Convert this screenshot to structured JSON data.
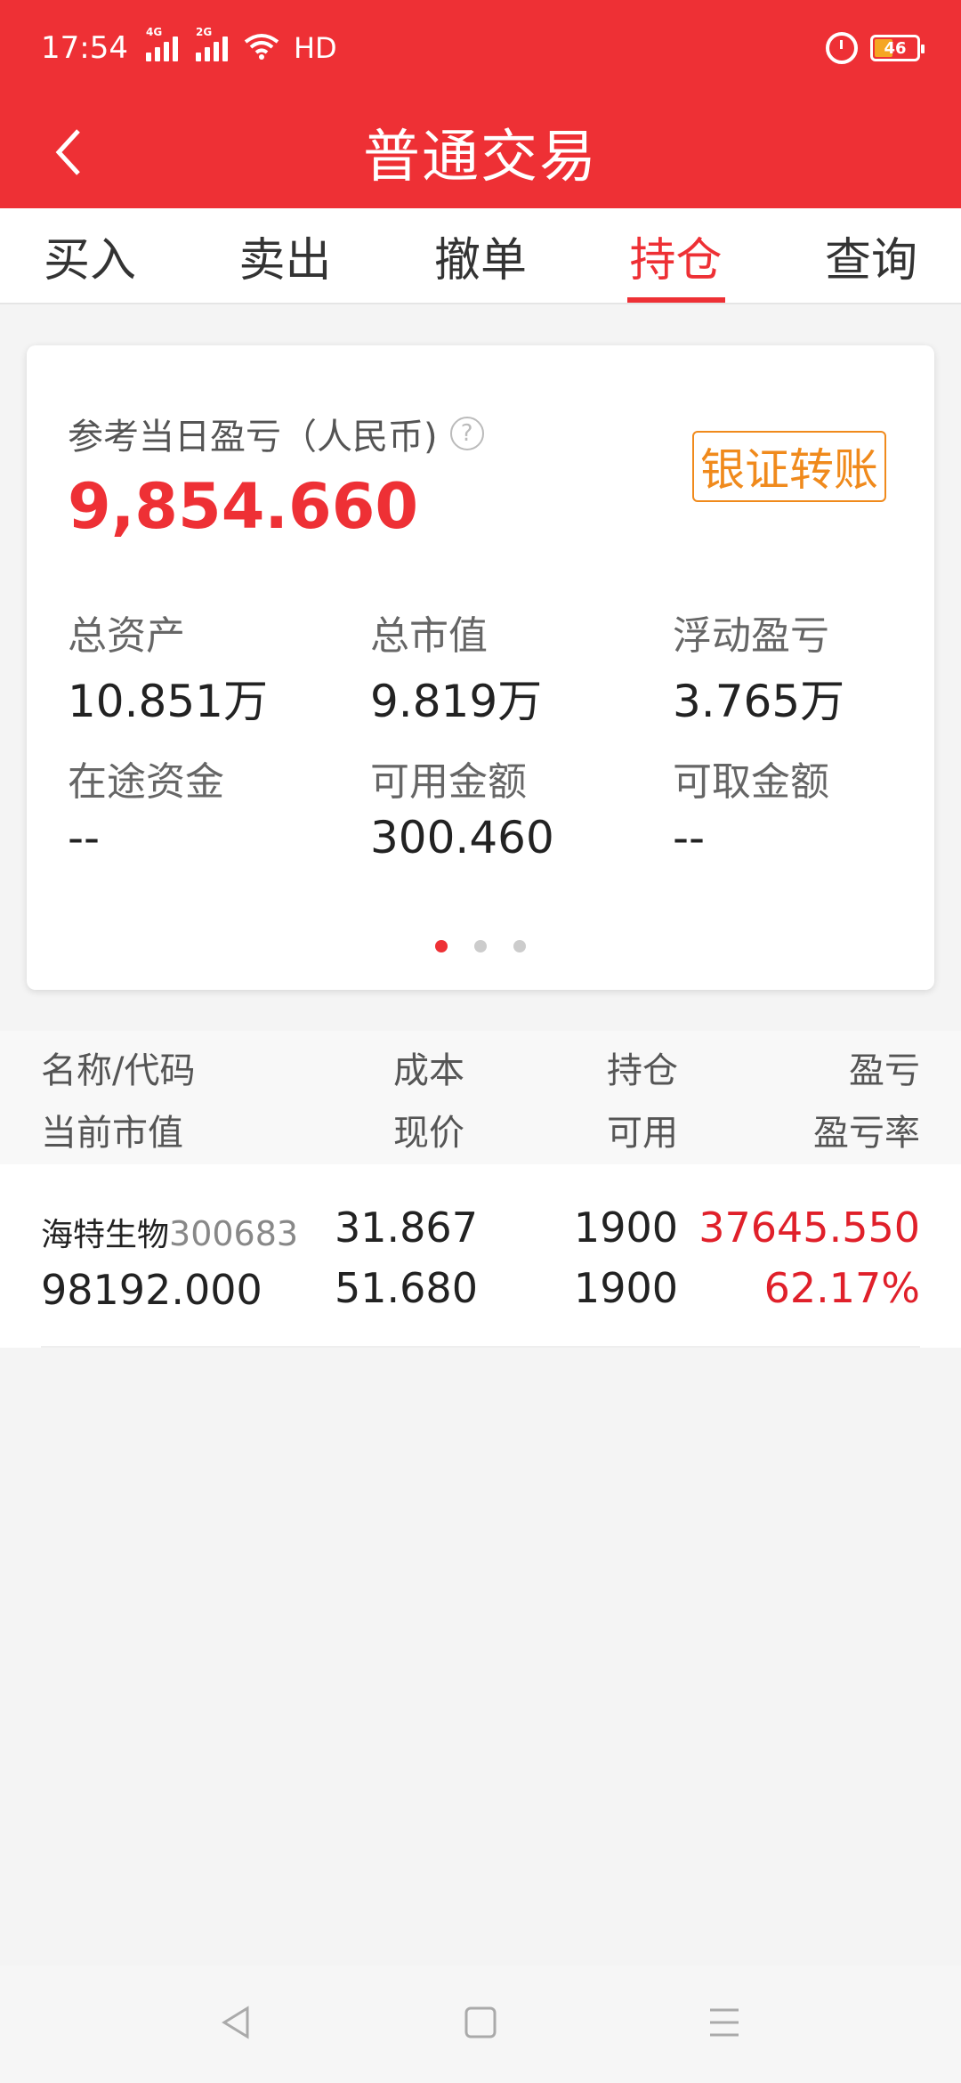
{
  "status_bar": {
    "time": "17:54",
    "signal1_label": "4G",
    "signal2_label": "2G",
    "wifi_label": "HD",
    "battery": "46"
  },
  "header": {
    "title": "普通交易"
  },
  "tabs": [
    {
      "label": "买入"
    },
    {
      "label": "卖出"
    },
    {
      "label": "撤单"
    },
    {
      "label": "持仓",
      "active": true
    },
    {
      "label": "查询"
    }
  ],
  "summary": {
    "ref_label": "参考当日盈亏（人民币)",
    "ref_value": "9,854.660",
    "transfer_button": "银证转账",
    "stats": [
      {
        "label": "总资产",
        "value": "10.851万"
      },
      {
        "label": "总市值",
        "value": "9.819万"
      },
      {
        "label": "浮动盈亏",
        "value": "3.765万"
      },
      {
        "label": "在途资金",
        "value": "--"
      },
      {
        "label": "可用金额",
        "value": "300.460"
      },
      {
        "label": "可取金额",
        "value": "--"
      }
    ],
    "page_count": 3,
    "active_page": 1
  },
  "table": {
    "headers": {
      "name_code": "名称/代码",
      "cost": "成本",
      "position": "持仓",
      "pnl": "盈亏",
      "market_value": "当前市值",
      "price": "现价",
      "available": "可用",
      "pnl_rate": "盈亏率"
    },
    "rows": [
      {
        "name": "海特生物",
        "code": "300683",
        "cost": "31.867",
        "position": "1900",
        "pnl": "37645.550",
        "market_value": "98192.000",
        "price": "51.680",
        "available": "1900",
        "pnl_rate": "62.17%"
      }
    ]
  },
  "colors": {
    "brand_red": "#ee3035",
    "profit_red": "#e0202a",
    "transfer_orange": "#f08a1c"
  }
}
